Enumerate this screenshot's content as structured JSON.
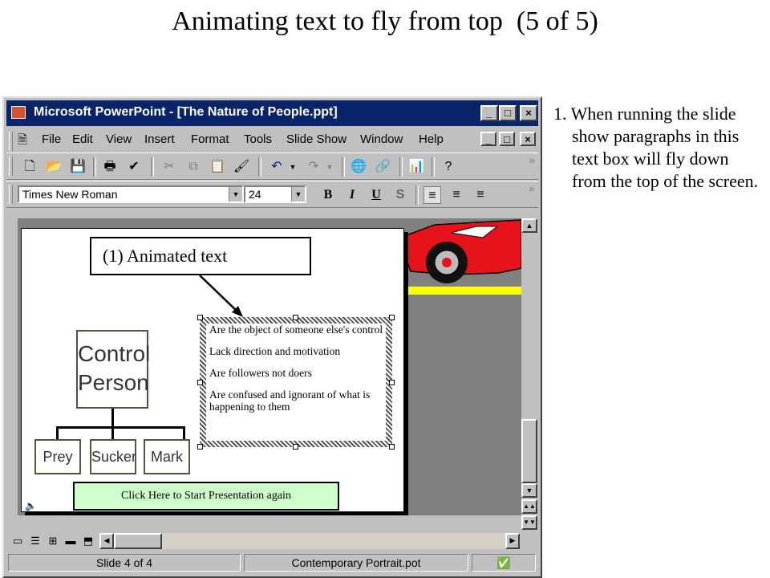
{
  "slide_title": "Animating text to fly from top  (5 of 5)",
  "caption": "1. When running the slide show paragraphs in this text box  will fly down from the top of the screen.",
  "window": {
    "title": "Microsoft PowerPoint - [The Nature of People.ppt]",
    "controls": {
      "minimize": "_",
      "maximize": "□",
      "close": "×"
    }
  },
  "menu": [
    "File",
    "Edit",
    "View",
    "Insert",
    "Format",
    "Tools",
    "Slide Show",
    "Window",
    "Help"
  ],
  "formatting": {
    "font": "Times New Roman",
    "size": "24",
    "bold": "B",
    "italic": "I",
    "underline": "U",
    "shadow": "S"
  },
  "slide": {
    "callout": "(1) Animated text",
    "org_chart": {
      "top": "Control Person",
      "children": [
        "Prey",
        "Sucker",
        "Mark"
      ]
    },
    "bullets": [
      "Are the object of someone else's control",
      "Lack direction and motivation",
      "Are followers not doers",
      "Are confused and ignorant of what is happening to them"
    ],
    "start_button": "Click Here to Start Presentation again"
  },
  "status": {
    "slide": "Slide 4 of 4",
    "design": "Contemporary Portrait.pot"
  },
  "colors": {
    "titlebar": "#0a246a",
    "chrome": "#c0c0c0",
    "workspace": "#808080",
    "start_button": "#ccffcc",
    "car": "#e8121a"
  }
}
